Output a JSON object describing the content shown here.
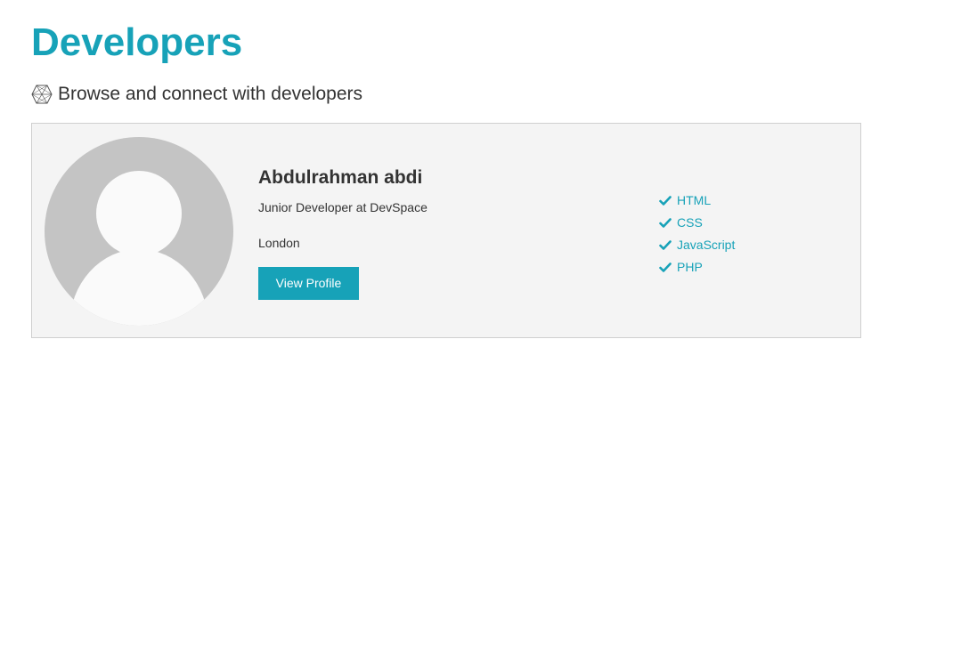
{
  "page": {
    "title": "Developers",
    "lead": "Browse and connect with developers",
    "lead_icon": "connectdevelop-icon",
    "accent_color": "#17a2b8"
  },
  "profiles": [
    {
      "avatar_icon": "default-user-avatar",
      "name": "Abdulrahman abdi",
      "status": "Junior Developer at DevSpace",
      "location": "London",
      "button_label": "View Profile",
      "skills": [
        "HTML",
        "CSS",
        "JavaScript",
        "PHP"
      ]
    }
  ]
}
